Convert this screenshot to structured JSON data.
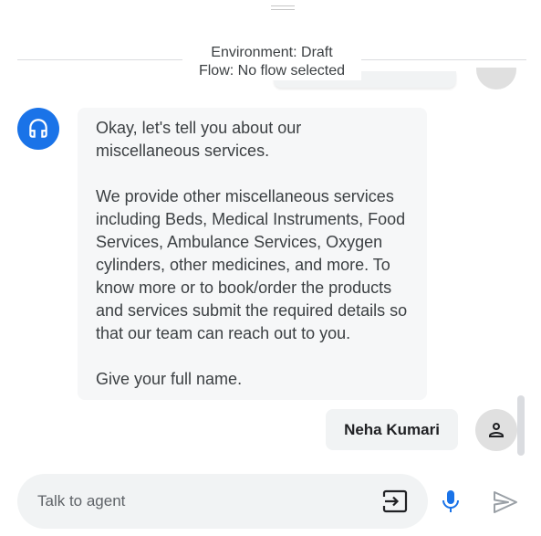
{
  "header": {
    "environment": "Environment: Draft",
    "flow": "Flow: No flow selected"
  },
  "messages": [
    {
      "sender": "agent",
      "avatar_icon": "headset-icon",
      "paragraphs": [
        "Okay, let's tell you about our miscellaneous services.",
        "We provide other miscellaneous services including Beds, Medical Instruments, Food Services, Ambulance Services, Oxygen cylinders, other medicines, and more. To know more or to book/order the products and services submit the required details so that our team can reach out to you.",
        "Give your full name."
      ]
    },
    {
      "sender": "user",
      "avatar_icon": "person-icon",
      "text": "Neha Kumari"
    }
  ],
  "composer": {
    "placeholder": "Talk to agent",
    "icons": [
      "transfer-to-agent-icon",
      "microphone-icon",
      "send-icon"
    ]
  },
  "colors": {
    "agent_avatar": "#1a73e8",
    "mic": "#1a73e8",
    "send_disabled": "#9aa0a6",
    "bubble": "#f6f7f8",
    "input_bg": "#f1f3f4"
  }
}
